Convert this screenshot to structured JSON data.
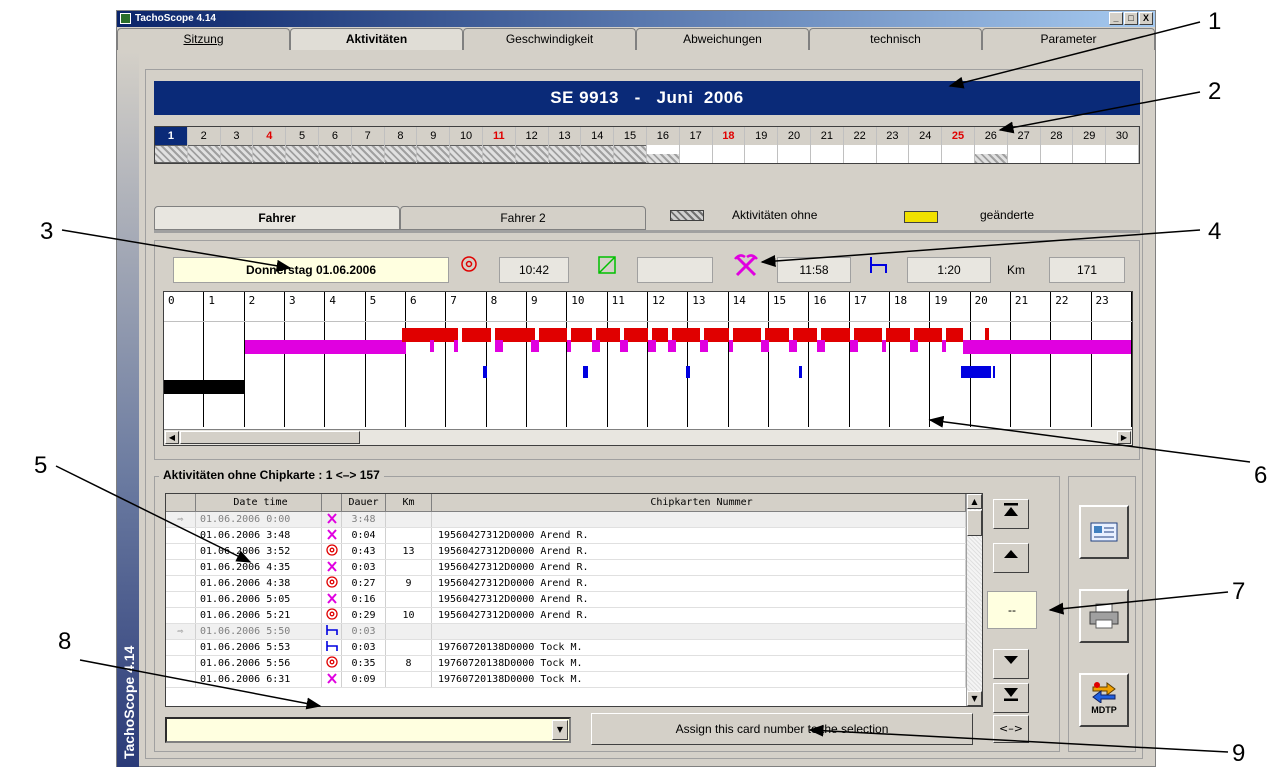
{
  "window": {
    "title": "TachoScope 4.14",
    "buttons": [
      "_",
      "□",
      "X"
    ]
  },
  "top_tabs": [
    "Sitzung",
    "Aktivitäten",
    "Geschwindigkeit",
    "Abweichungen",
    "technisch",
    "Parameter"
  ],
  "active_top_tab": "Aktivitäten",
  "sidebar_text": "TachoScope 4.14",
  "header": {
    "title": "SE 9913   -   Juni  2006"
  },
  "days": [
    "1",
    "2",
    "3",
    "4",
    "5",
    "6",
    "7",
    "8",
    "9",
    "10",
    "11",
    "12",
    "13",
    "14",
    "15",
    "16",
    "17",
    "18",
    "19",
    "20",
    "21",
    "22",
    "23",
    "24",
    "25",
    "26",
    "27",
    "28",
    "29",
    "30"
  ],
  "driver_tabs": {
    "tab1": "Fahrer",
    "tab2": "Fahrer 2"
  },
  "legend": {
    "no_card": "Aktivitäten ohne",
    "changed": "geänderte"
  },
  "day_summary": {
    "date": "Donnerstag 01.06.2006",
    "driving": "10:42",
    "available": "",
    "work": "11:58",
    "rest": "1:20",
    "km_label": "Km",
    "km": "171"
  },
  "hours": [
    "0",
    "1",
    "2",
    "3",
    "4",
    "5",
    "6",
    "7",
    "8",
    "9",
    "10",
    "11",
    "12",
    "13",
    "14",
    "15",
    "16",
    "17",
    "18",
    "19",
    "20",
    "21",
    "22",
    "23"
  ],
  "activities_box": {
    "label": "Aktivitäten ohne Chipkarte :   1 <–> 157"
  },
  "grid": {
    "headers": [
      "",
      "Date time",
      "",
      "Dauer",
      "Km",
      "Chipkarten Nummer"
    ],
    "rows": [
      {
        "mark": "⇨",
        "datetime": "01.06.2006 0:00",
        "icon": "work",
        "dauer": "3:48",
        "km": "",
        "card": "",
        "gray": true
      },
      {
        "mark": "",
        "datetime": "01.06.2006 3:48",
        "icon": "work",
        "dauer": "0:04",
        "km": "",
        "card": "19560427312D0000 Arend R.",
        "gray": false
      },
      {
        "mark": "",
        "datetime": "01.06.2006 3:52",
        "icon": "drive",
        "dauer": "0:43",
        "km": "13",
        "card": "19560427312D0000 Arend R.",
        "gray": false
      },
      {
        "mark": "",
        "datetime": "01.06.2006 4:35",
        "icon": "work",
        "dauer": "0:03",
        "km": "",
        "card": "19560427312D0000 Arend R.",
        "gray": false
      },
      {
        "mark": "",
        "datetime": "01.06.2006 4:38",
        "icon": "drive",
        "dauer": "0:27",
        "km": "9",
        "card": "19560427312D0000 Arend R.",
        "gray": false
      },
      {
        "mark": "",
        "datetime": "01.06.2006 5:05",
        "icon": "work",
        "dauer": "0:16",
        "km": "",
        "card": "19560427312D0000 Arend R.",
        "gray": false
      },
      {
        "mark": "",
        "datetime": "01.06.2006 5:21",
        "icon": "drive",
        "dauer": "0:29",
        "km": "10",
        "card": "19560427312D0000 Arend R.",
        "gray": false
      },
      {
        "mark": "⇨",
        "datetime": "01.06.2006 5:50",
        "icon": "rest",
        "dauer": "0:03",
        "km": "",
        "card": "",
        "gray": true
      },
      {
        "mark": "",
        "datetime": "01.06.2006 5:53",
        "icon": "rest",
        "dauer": "0:03",
        "km": "",
        "card": "19760720138D0000 Tock M.",
        "gray": false
      },
      {
        "mark": "",
        "datetime": "01.06.2006 5:56",
        "icon": "drive",
        "dauer": "0:35",
        "km": "8",
        "card": "19760720138D0000 Tock M.",
        "gray": false
      },
      {
        "mark": "",
        "datetime": "01.06.2006 6:31",
        "icon": "work",
        "dauer": "0:09",
        "km": "",
        "card": "19760720138D0000 Tock M.",
        "gray": false
      }
    ]
  },
  "counter": "--",
  "assign_button": "Assign this card number to the selection",
  "swap_button": "<–>",
  "mdtp_label": "MDTP",
  "callouts": [
    "1",
    "2",
    "3",
    "4",
    "5",
    "6",
    "7",
    "8",
    "9"
  ],
  "colors": {
    "drive": "#e00000",
    "work": "#e000e0",
    "rest": "#0000e0",
    "available": "#00c000",
    "header": "#0a2a78"
  }
}
